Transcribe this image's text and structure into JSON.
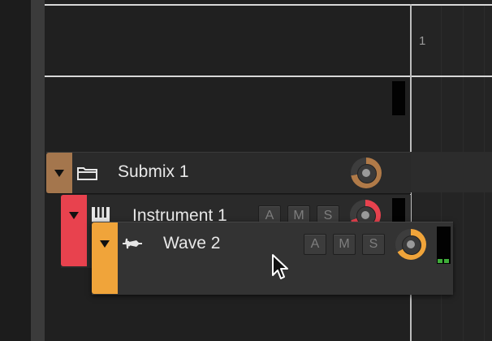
{
  "ruler": {
    "bar_number": "1"
  },
  "tracks": {
    "submix": {
      "name": "Submix 1",
      "color": "#a4764d",
      "icon": "folder-icon"
    },
    "instrument": {
      "name": "Instrument 1",
      "color": "#e8424e",
      "icon": "piano-keys-icon",
      "buttons": {
        "a": "A",
        "m": "M",
        "s": "S"
      }
    },
    "wave": {
      "name": "Wave 2",
      "color": "#f0a43a",
      "icon": "waveform-icon",
      "buttons": {
        "a": "A",
        "m": "M",
        "s": "S"
      }
    }
  },
  "colors": {
    "meter_green": "#3fae3a",
    "knob_ring": "#3d3d3d"
  }
}
